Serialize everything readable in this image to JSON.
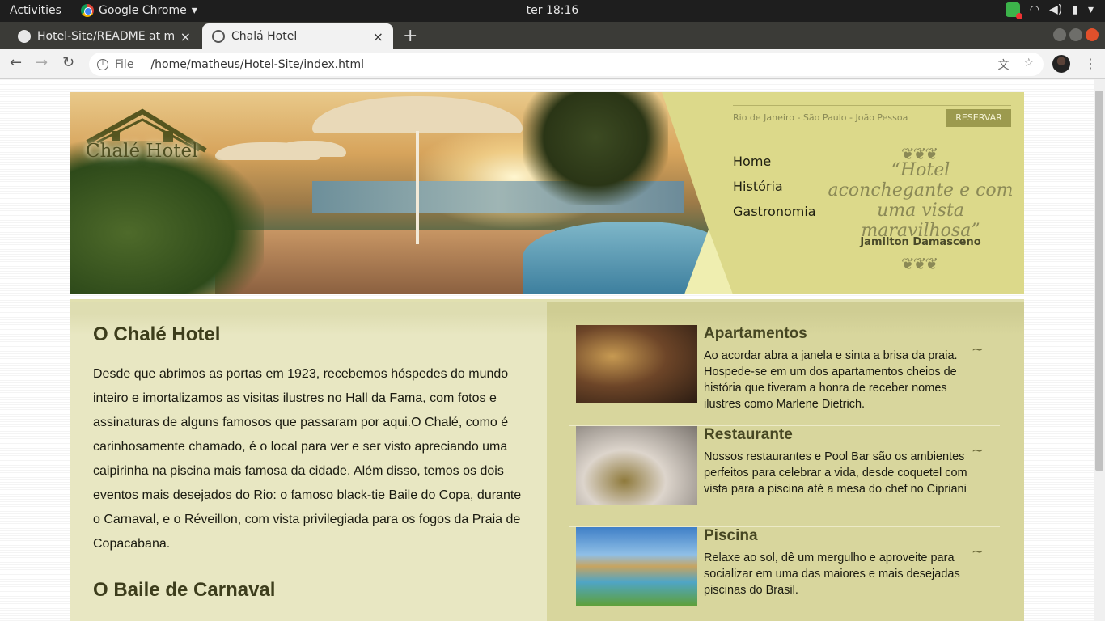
{
  "system": {
    "activities": "Activities",
    "app_name": "Google Chrome",
    "clock": "ter 18:16"
  },
  "tabs": [
    {
      "title": "Hotel-Site/README at ma",
      "close": "×"
    },
    {
      "title": "Chalá Hotel",
      "close": "×"
    }
  ],
  "new_tab": "+",
  "address": {
    "scheme_label": "File",
    "url": "/home/matheus/Hotel-Site/index.html"
  },
  "header": {
    "logo_text": "Chalé Hotel",
    "cities": "Rio de Janeiro - São Paulo - João Pessoa",
    "reserve_button": "RESERVAR",
    "menu": [
      "Home",
      "História",
      "Gastronomia"
    ],
    "quote": "“Hotel aconchegante e com uma vista maravilhosa”",
    "quote_author": "Jamilton Damasceno"
  },
  "intro": {
    "title": "O Chalé Hotel",
    "text": "Desde que abrimos as portas em 1923, recebemos hóspedes do mundo inteiro e imortalizamos as visitas ilustres no Hall da Fama, com fotos e assinaturas de alguns famosos que passaram por aqui.O Chalé, como é carinhosamente chamado, é o local para ver e ser visto apreciando uma caipirinha na piscina mais famosa da cidade. Além disso, temos os dois eventos mais desejados do Rio: o famoso black-tie Baile do Copa, durante o Carnaval, e o Réveillon, com vista privilegiada para os fogos da Praia de Copacabana."
  },
  "carnival": {
    "title": "O Baile de Carnaval"
  },
  "features": [
    {
      "title": "Apartamentos",
      "text": "Ao acordar abra a janela e sinta a brisa da praia. Hospede-se em um dos apartamentos cheios de história que tiveram a honra de receber nomes ilustres como Marlene Dietrich."
    },
    {
      "title": "Restaurante",
      "text": "Nossos restaurantes e Pool Bar são os ambientes perfeitos para celebrar a vida, desde coquetel com vista para a piscina até a mesa do chef no Cipriani"
    },
    {
      "title": "Piscina",
      "text": "Relaxe ao sol, dê um mergulho e aproveite para socializar em uma das maiores e mais desejadas piscinas do Brasil."
    }
  ]
}
